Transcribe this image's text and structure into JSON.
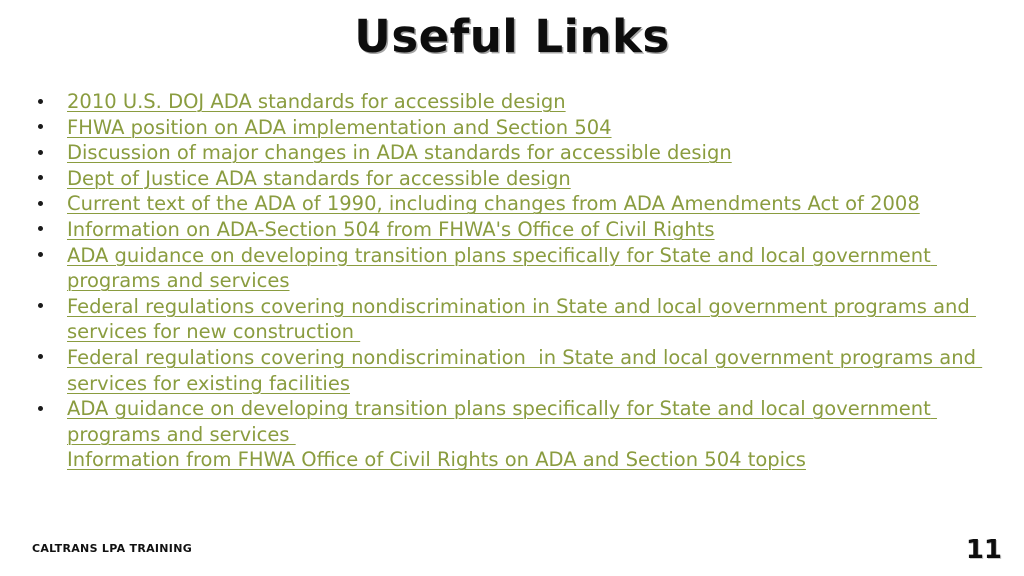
{
  "slide": {
    "title": "Useful Links",
    "footer_label": "CALTRANS LPA TRAINING",
    "page_number": "11",
    "accent_color": "#8a9c3f",
    "title_color": "#0d0d0d",
    "background_color": "#ffffff"
  },
  "links": [
    {
      "text": "2010 U.S. DOJ ADA standards for accessible design",
      "bulleted": true
    },
    {
      "text": "FHWA position on ADA implementation and Section 504",
      "bulleted": true
    },
    {
      "text": "Discussion of major changes in ADA standards for accessible design",
      "bulleted": true
    },
    {
      "text": "Dept of Justice ADA standards for accessible design",
      "bulleted": true
    },
    {
      "text": "Current text of the ADA of 1990, including changes from ADA Amendments Act of 2008",
      "bulleted": true
    },
    {
      "text": "Information on ADA-Section 504 from FHWA's Office of Civil Rights",
      "bulleted": true
    },
    {
      "text": "ADA guidance on developing transition plans specifically for State and local government programs and services",
      "bulleted": true
    },
    {
      "text": "Federal regulations covering nondiscrimination in State and local government programs and services for new construction ",
      "bulleted": true
    },
    {
      "text": "Federal regulations covering nondiscrimination  in State and local government programs and services for existing facilities",
      "bulleted": true
    },
    {
      "text": "ADA guidance on developing transition plans specifically for State and local government programs and services ",
      "bulleted": true
    },
    {
      "text": "Information from FHWA Office of Civil Rights on ADA and Section 504 topics",
      "bulleted": false
    }
  ]
}
